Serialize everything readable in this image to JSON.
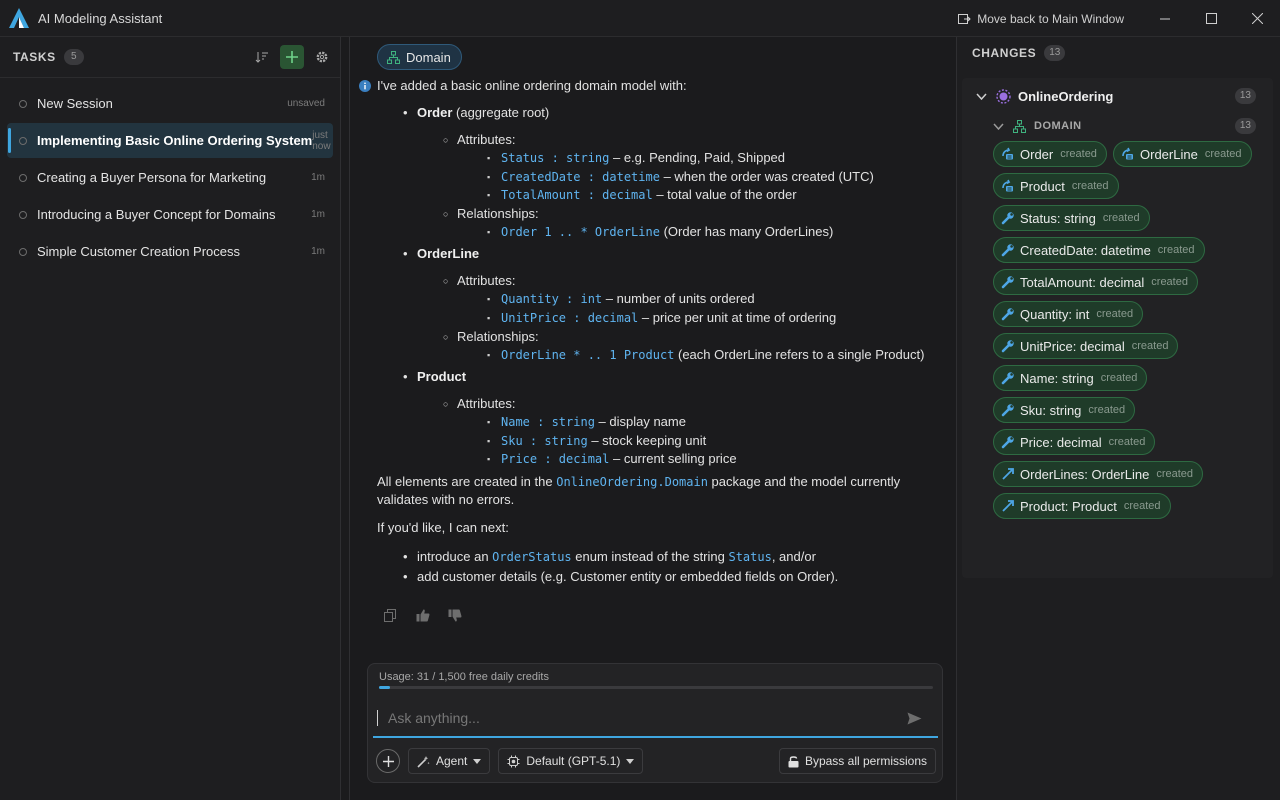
{
  "window": {
    "title": "AI Modeling Assistant",
    "move_back_label": "Move back to Main Window"
  },
  "tasks": {
    "title": "TASKS",
    "count": "5",
    "items": [
      {
        "title": "New Session",
        "meta": "unsaved",
        "active": false
      },
      {
        "title": "Implementing Basic Online Ordering System",
        "meta": "just now",
        "active": true
      },
      {
        "title": "Creating a Buyer Persona for Marketing",
        "meta": "1m",
        "active": false
      },
      {
        "title": "Introducing a Buyer Concept for Domains",
        "meta": "1m",
        "active": false
      },
      {
        "title": "Simple Customer Creation Process",
        "meta": "1m",
        "active": false
      }
    ]
  },
  "chat": {
    "context_chip": "Domain",
    "intro": "I've added a basic online ordering domain model with:",
    "attributes_label": "Attributes:",
    "relationships_label": "Relationships:",
    "entities": {
      "order": {
        "name": "Order",
        "suffix": " (aggregate root)",
        "attrs": [
          {
            "code": "Status : string",
            "desc": " – e.g. Pending, Paid, Shipped"
          },
          {
            "code": "CreatedDate : datetime",
            "desc": " – when the order was created (UTC)"
          },
          {
            "code": "TotalAmount : decimal",
            "desc": " – total value of the order"
          }
        ],
        "rel": {
          "code": "Order 1 .. * OrderLine",
          "desc": " (Order has many OrderLines)"
        }
      },
      "orderline": {
        "name": "OrderLine",
        "attrs": [
          {
            "code": "Quantity : int",
            "desc": " – number of units ordered"
          },
          {
            "code": "UnitPrice : decimal",
            "desc": " – price per unit at time of ordering"
          }
        ],
        "rel": {
          "code": "OrderLine * .. 1 Product",
          "desc": " (each OrderLine refers to a single Product)"
        }
      },
      "product": {
        "name": "Product",
        "attrs": [
          {
            "code": "Name : string",
            "desc": " – display name"
          },
          {
            "code": "Sku : string",
            "desc": " – stock keeping unit"
          },
          {
            "code": "Price : decimal",
            "desc": " – current selling price"
          }
        ]
      }
    },
    "package_pre": "All elements are created in the ",
    "package_code": "OnlineOrdering.Domain",
    "package_post": " package and the model currently validates with no errors.",
    "next_intro": "If you'd like, I can next:",
    "next1_pre": "introduce an ",
    "next1_code": "OrderStatus",
    "next1_mid": " enum instead of the string ",
    "next1_code2": "Status",
    "next1_post": ", and/or",
    "next2": "add customer details (e.g. Customer entity or embedded fields on Order)."
  },
  "composer": {
    "usage": "Usage: 31 / 1,500 free daily credits",
    "usage_fraction": 0.0207,
    "placeholder": "Ask anything...",
    "agent_label": "Agent",
    "model_label": "Default (GPT-5.1)",
    "bypass_label": "Bypass all permissions"
  },
  "changes": {
    "title": "CHANGES",
    "count": "13",
    "package": {
      "name": "OnlineOrdering",
      "count": "13"
    },
    "folder": {
      "name": "DOMAIN",
      "count": "13"
    },
    "items": [
      {
        "name": "Order",
        "status": "created",
        "kind": "entity"
      },
      {
        "name": "OrderLine",
        "status": "created",
        "kind": "entity"
      },
      {
        "name": "Product",
        "status": "created",
        "kind": "entity"
      },
      {
        "name": "Status: string",
        "status": "created",
        "kind": "attribute"
      },
      {
        "name": "CreatedDate: datetime",
        "status": "created",
        "kind": "attribute"
      },
      {
        "name": "TotalAmount: decimal",
        "status": "created",
        "kind": "attribute"
      },
      {
        "name": "Quantity: int",
        "status": "created",
        "kind": "attribute"
      },
      {
        "name": "UnitPrice: decimal",
        "status": "created",
        "kind": "attribute"
      },
      {
        "name": "Name: string",
        "status": "created",
        "kind": "attribute"
      },
      {
        "name": "Sku: string",
        "status": "created",
        "kind": "attribute"
      },
      {
        "name": "Price: decimal",
        "status": "created",
        "kind": "attribute"
      },
      {
        "name": "OrderLines: OrderLine",
        "status": "created",
        "kind": "association"
      },
      {
        "name": "Product: Product",
        "status": "created",
        "kind": "association"
      }
    ]
  },
  "colors": {
    "accent": "#3fa6e0",
    "code": "#5fb4f0",
    "pill_bg": "#1f3b29",
    "add_button": "#2a5533"
  }
}
